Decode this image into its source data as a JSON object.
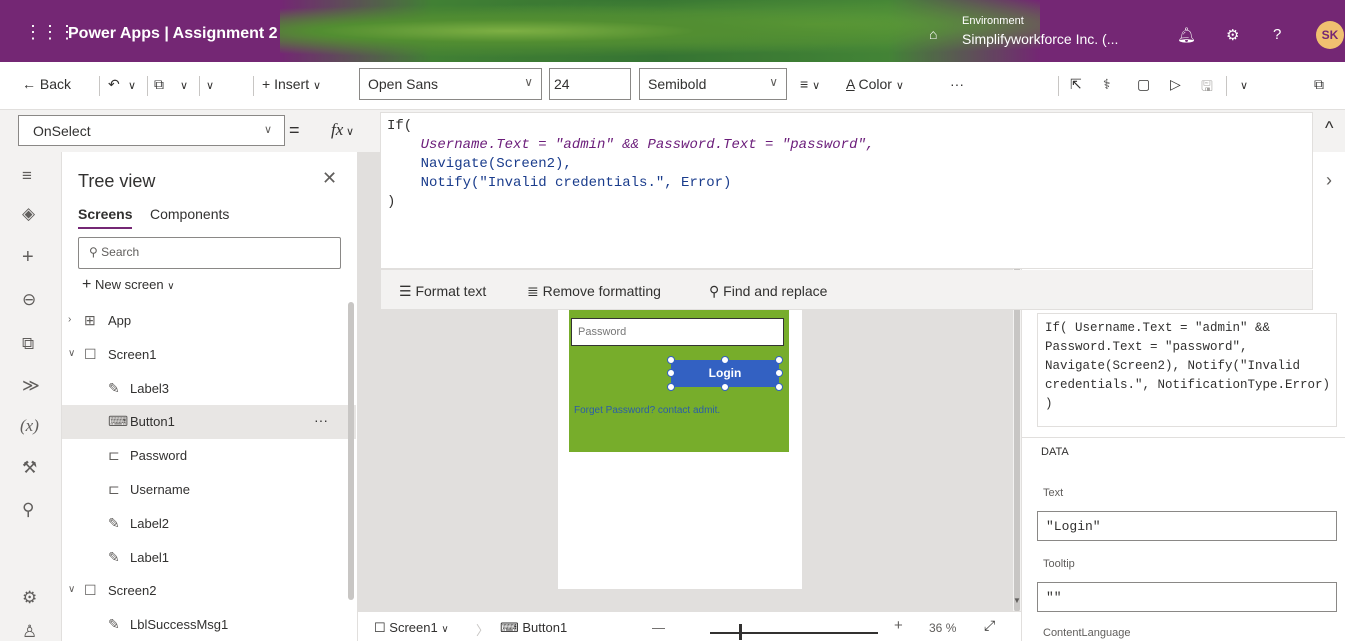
{
  "titlebar": {
    "waffle": "⋮⋮⋮",
    "app_title": "Power Apps | Assignment 2",
    "env_label": "Environment",
    "env_value": "Simplifyworkforce Inc. (...",
    "avatar": "SK",
    "icons": [
      "environment-icon",
      "bell-icon",
      "gear-icon",
      "help-icon"
    ]
  },
  "toolbar": {
    "back": "Back",
    "insert": "Insert",
    "font": "Open Sans",
    "font_size": "24",
    "font_weight": "Semibold",
    "color": "Color",
    "more": "···"
  },
  "formulabar": {
    "property": "OnSelect",
    "eq": "=",
    "fx": "fx",
    "lines": [
      "If(",
      "    Username.Text = \"admin\" && Password.Text = \"password\",",
      "    Navigate(Screen2),",
      "    Notify(\"Invalid credentials.\", Error)",
      ")"
    ],
    "tools": {
      "format_text": "Format text",
      "remove_formatting": "Remove formatting",
      "find_replace": "Find and replace"
    }
  },
  "tree": {
    "title": "Tree view",
    "tabs": {
      "screens": "Screens",
      "components": "Components"
    },
    "search_placeholder": "Search",
    "new_screen": "New screen",
    "items": [
      {
        "label": "App",
        "indent": 0,
        "icon": "app-icon"
      },
      {
        "label": "Screen1",
        "indent": 0,
        "icon": "screen-icon"
      },
      {
        "label": "Label3",
        "indent": 1,
        "icon": "label-icon"
      },
      {
        "label": "Button1",
        "indent": 1,
        "icon": "button-icon",
        "selected": true
      },
      {
        "label": "Password",
        "indent": 1,
        "icon": "textinput-icon"
      },
      {
        "label": "Username",
        "indent": 1,
        "icon": "textinput-icon"
      },
      {
        "label": "Label2",
        "indent": 1,
        "icon": "label-icon"
      },
      {
        "label": "Label1",
        "indent": 1,
        "icon": "label-icon"
      },
      {
        "label": "Screen2",
        "indent": 0,
        "icon": "screen-icon"
      },
      {
        "label": "LblSuccessMsg1",
        "indent": 1,
        "icon": "label-icon"
      }
    ],
    "more": "···"
  },
  "canvas": {
    "password_placeholder": "Password",
    "login_label": "Login",
    "forget_text": "Forget Password? contact admit.",
    "green": "#77ad2b",
    "button_color": "#3361c2"
  },
  "bottombar": {
    "screen": "Screen1",
    "control": "Button1",
    "zoom_minus": "—",
    "zoom_plus": "+",
    "zoom": "36",
    "zoom_unit": "%"
  },
  "rightpanel": {
    "formula_lines": [
      "If( Username.Text = \"admin\" &&",
      "Password.Text = \"password\",",
      "Navigate(Screen2), Notify(\"Invalid",
      "credentials.\", NotificationType.Error)",
      ")"
    ],
    "data_header": "DATA",
    "text_label": "Text",
    "text_value": "\"Login\"",
    "tooltip_label": "Tooltip",
    "tooltip_value": "\"\"",
    "content_language_label": "ContentLanguage"
  },
  "colors": {
    "brand": "#742774",
    "accent": "#3361c2"
  }
}
